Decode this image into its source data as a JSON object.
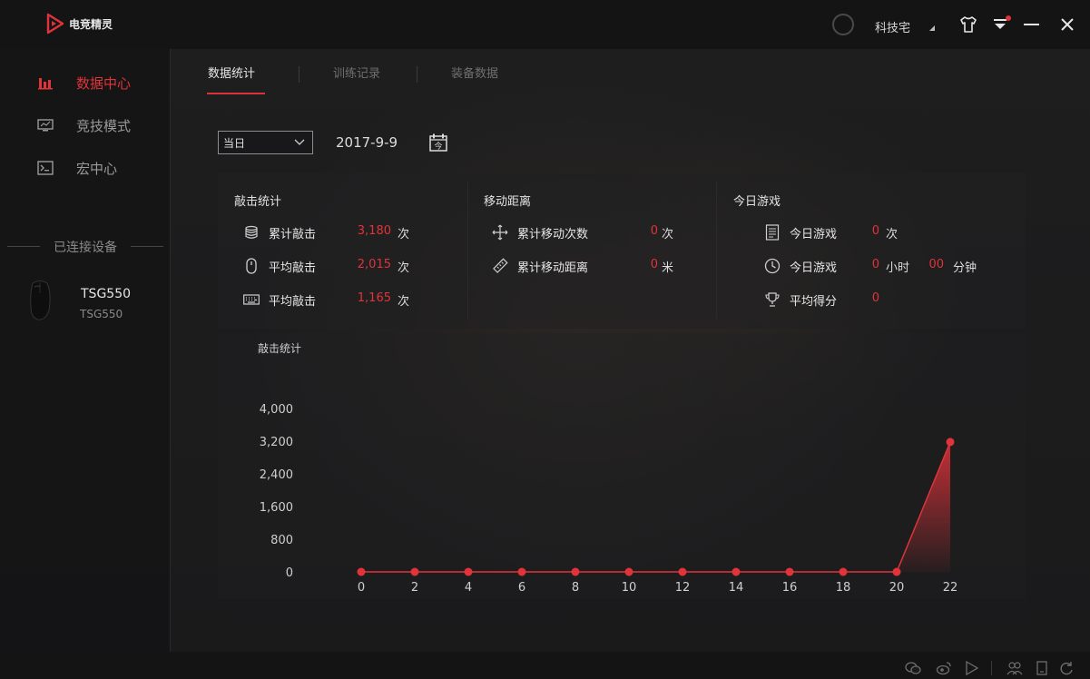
{
  "app": {
    "title": "电竞精灵"
  },
  "titlebar": {
    "user_name": "科技宅"
  },
  "sidebar": {
    "items": [
      {
        "label": "数据中心",
        "icon": "bar-chart-icon",
        "active": true
      },
      {
        "label": "竞技模式",
        "icon": "monitor-icon",
        "active": false
      },
      {
        "label": "宏中心",
        "icon": "terminal-icon",
        "active": false
      }
    ],
    "devices_heading": "已连接设备",
    "device": {
      "name": "TSG550",
      "model": "TSG550",
      "icon": "mouse-icon"
    }
  },
  "tabs": [
    {
      "label": "数据统计",
      "active": true
    },
    {
      "label": "训练记录",
      "active": false
    },
    {
      "label": "装备数据",
      "active": false
    }
  ],
  "date_row": {
    "range_selected": "当日",
    "date": "2017-9-9",
    "calendar_icon_text": "今"
  },
  "stats": {
    "keystrokes": {
      "title": "敲击统计",
      "rows": [
        {
          "label": "累计敲击",
          "value": "3,180",
          "unit": "次",
          "icon": "database-icon"
        },
        {
          "label": "平均敲击",
          "value": "2,015",
          "unit": "次",
          "icon": "mouse-icon"
        },
        {
          "label": "平均敲击",
          "value": "1,165",
          "unit": "次",
          "icon": "keyboard-icon"
        }
      ]
    },
    "movement": {
      "title": "移动距离",
      "rows": [
        {
          "label": "累计移动次数",
          "value": "0",
          "unit": "次",
          "icon": "move-icon"
        },
        {
          "label": "累计移动距离",
          "value": "0",
          "unit": "米",
          "icon": "ruler-icon"
        }
      ]
    },
    "today": {
      "title": "今日游戏",
      "rows": [
        {
          "label": "今日游戏",
          "value": "0",
          "unit": "次",
          "icon": "list-icon"
        },
        {
          "label": "今日游戏",
          "value": "0",
          "unit": "小时",
          "value2": "00",
          "unit2": "分钟",
          "icon": "clock-icon"
        },
        {
          "label": "平均得分",
          "value": "0",
          "unit": "",
          "icon": "trophy-icon"
        }
      ]
    }
  },
  "colors": {
    "accent": "#e0333a",
    "accent_line": "#d8323a"
  },
  "chart_data": {
    "type": "area",
    "title": "敲击统计",
    "xlabel": "",
    "ylabel": "",
    "x": [
      0,
      2,
      4,
      6,
      8,
      10,
      12,
      14,
      16,
      18,
      20,
      22
    ],
    "y": [
      0,
      0,
      0,
      0,
      0,
      0,
      0,
      0,
      0,
      0,
      0,
      3180
    ],
    "y_ticks": [
      "4,000",
      "3,200",
      "2,400",
      "1,600",
      "800",
      "0"
    ],
    "y_tick_values": [
      4000,
      3200,
      2400,
      1600,
      800,
      0
    ],
    "x_ticks": [
      "0",
      "2",
      "4",
      "6",
      "8",
      "10",
      "12",
      "14",
      "16",
      "18",
      "20",
      "22"
    ],
    "ylim": [
      0,
      4000
    ],
    "grid": false,
    "legend": "none"
  },
  "footer": {
    "icons": [
      "wechat-icon",
      "weibo-icon",
      "share-icon",
      "team-icon",
      "device-icon",
      "refresh-icon"
    ]
  }
}
